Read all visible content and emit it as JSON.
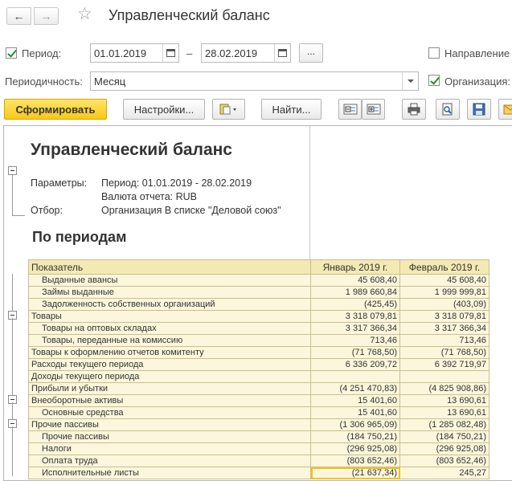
{
  "header": {
    "title": "Управленческий баланс",
    "back_icon": "←",
    "forward_icon": "→",
    "favorite_icon": "☆"
  },
  "filters": {
    "period_label": "Период:",
    "period_checked": true,
    "date_from": "01.01.2019",
    "dash": "–",
    "date_to": "28.02.2019",
    "dots_label": "...",
    "direction_label": "Направление",
    "direction_checked": false,
    "periodicity_label": "Периодичность:",
    "periodicity_value": "Месяц",
    "organization_label": "Организация:",
    "organization_checked": true
  },
  "toolbar": {
    "generate_label": "Сформировать",
    "settings_label": "Настройки...",
    "find_label": "Найти..."
  },
  "report": {
    "title": "Управленческий баланс",
    "params_label": "Параметры:",
    "params_period": "Период: 01.01.2019 - 28.02.2019",
    "params_currency": "Валюта отчета: RUB",
    "filter_label": "Отбор:",
    "filter_value": "Организация В списке \"Деловой союз\"",
    "subtitle": "По периодам",
    "columns": [
      "Показатель",
      "Январь 2019 г.",
      "Февраль 2019 г."
    ],
    "rows": [
      {
        "name": "Выданные авансы",
        "jan": "45 608,40",
        "feb": "45 608,40"
      },
      {
        "name": "Займы выданные",
        "jan": "1 989 660,84",
        "feb": "1 999 999,81"
      },
      {
        "name": "Задолженность собственных организаций",
        "jan": "(425,45)",
        "feb": "(403,09)"
      },
      {
        "name": "Товары",
        "jan": "3 318 079,81",
        "feb": "3 318 079,81"
      },
      {
        "name": "Товары на оптовых складах",
        "jan": "3 317 366,34",
        "feb": "3 317 366,34"
      },
      {
        "name": "Товары, переданные на комиссию",
        "jan": "713,46",
        "feb": "713,46"
      },
      {
        "name": "Товары к оформлению отчетов комитенту",
        "jan": "(71 768,50)",
        "feb": "(71 768,50)"
      },
      {
        "name": "Расходы текущего периода",
        "jan": "6 336 209,72",
        "feb": "6 392 719,97"
      },
      {
        "name": "Доходы текущего периода",
        "jan": "",
        "feb": ""
      },
      {
        "name": "Прибыли и убытки",
        "jan": "(4 251 470,83)",
        "feb": "(4 825 908,86)"
      },
      {
        "name": "Внеоборотные активы",
        "jan": "15 401,60",
        "feb": "13 690,61"
      },
      {
        "name": "Основные средства",
        "jan": "15 401,60",
        "feb": "13 690,61"
      },
      {
        "name": "Прочие пассивы",
        "jan": "(1 306 965,09)",
        "feb": "(1 285 082,48)"
      },
      {
        "name": "Прочие пассивы",
        "jan": "(184 750,21)",
        "feb": "(184 750,21)"
      },
      {
        "name": "Налоги",
        "jan": "(296 925,08)",
        "feb": "(296 925,08)"
      },
      {
        "name": "Оплата труда",
        "jan": "(803 652,46)",
        "feb": "(803 652,46)"
      },
      {
        "name": "Исполнительные листы",
        "jan": "(21 637,34)",
        "feb": "245,27"
      }
    ]
  },
  "colors": {
    "primary_button": "#f7c914",
    "table_header": "#f3e9b3",
    "table_cell": "#fbf6dc",
    "highlight": "#f0c21c",
    "checkbox": "#2e8b2e"
  }
}
